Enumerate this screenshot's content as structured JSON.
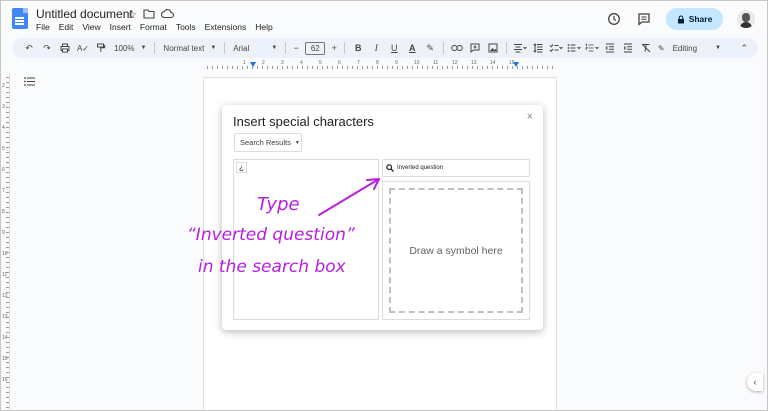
{
  "app": {
    "title": "Untitled document",
    "menu": [
      "File",
      "Edit",
      "View",
      "Insert",
      "Format",
      "Tools",
      "Extensions",
      "Help"
    ],
    "share_label": "Share",
    "icons": [
      "star-icon",
      "move-to-folder-icon",
      "cloud-saved-icon",
      "history-icon",
      "comments-icon",
      "lock-icon",
      "avatar"
    ]
  },
  "toolbar": {
    "zoom": "100%",
    "style": "Normal text",
    "font": "Arial",
    "font_size": "62",
    "mode": "Editing",
    "font_size_minus": "−",
    "font_size_plus": "+"
  },
  "ruler": {
    "h_numbers": [
      "1",
      "2",
      "3",
      "4",
      "5",
      "6",
      "7",
      "8",
      "9",
      "10",
      "11",
      "12",
      "13",
      "14",
      "15"
    ],
    "v_numbers": [
      "2",
      "3",
      "4",
      "5",
      "6",
      "7",
      "8",
      "9",
      "10",
      "11",
      "12",
      "13",
      "14",
      "15",
      "16"
    ]
  },
  "dialog": {
    "title": "Insert special characters",
    "close": "×",
    "category": "Search Results",
    "result_char": "¿",
    "search_value": "Inverted question",
    "draw_placeholder": "Draw a symbol here"
  },
  "annotation": {
    "line1": "Type",
    "line2": "“Inverted question”",
    "line3": "in the search box",
    "color": "#b620e0"
  },
  "colors": {
    "accent": "#1a73e8",
    "share_bg": "#c2e7ff",
    "toolbar_bg": "#edf2fa"
  }
}
